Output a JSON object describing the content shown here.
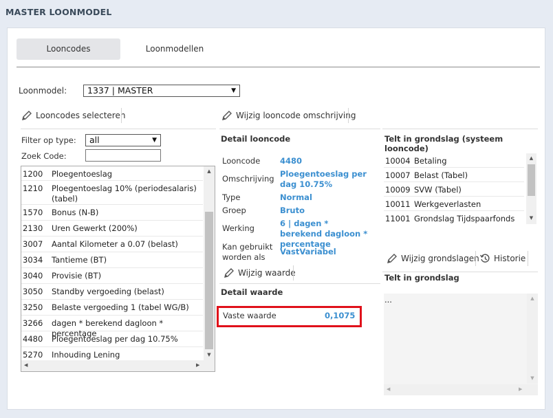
{
  "page": {
    "title": "MASTER LOONMODEL"
  },
  "tabs": [
    {
      "label": "Looncodes",
      "active": true
    },
    {
      "label": "Loonmodellen",
      "active": false
    }
  ],
  "loonmodel": {
    "label": "Loonmodel:",
    "value": "1337 | MASTER"
  },
  "toolbar": {
    "select_codes": "Looncodes selecteren",
    "edit_description": "Wijzig looncode omschrijving",
    "edit_value": "Wijzig waarde",
    "edit_grondslagen": "Wijzig grondslagen",
    "history": "Historie"
  },
  "filter": {
    "type_label": "Filter op type:",
    "type_value": "all",
    "search_label": "Zoek Code:",
    "search_value": ""
  },
  "looncodes": [
    {
      "code": "1200",
      "description": "Ploegentoeslag"
    },
    {
      "code": "1210",
      "description": "Ploegentoeslag 10% (periodesalaris) (tabel)"
    },
    {
      "code": "1570",
      "description": "Bonus (N-B)"
    },
    {
      "code": "2130",
      "description": "Uren Gewerkt (200%)"
    },
    {
      "code": "3007",
      "description": "Aantal Kilometer a 0.07 (belast)"
    },
    {
      "code": "3034",
      "description": "Tantieme (BT)"
    },
    {
      "code": "3040",
      "description": "Provisie (BT)"
    },
    {
      "code": "3050",
      "description": "Standby vergoeding (belast)"
    },
    {
      "code": "3250",
      "description": "Belaste vergoeding 1 (tabel WG/B)"
    },
    {
      "code": "3266",
      "description": "dagen * berekend dagloon * percentage"
    },
    {
      "code": "4480",
      "description": "Ploegentoeslag per dag 10.75%"
    },
    {
      "code": "5270",
      "description": "Inhouding Lening"
    }
  ],
  "detail": {
    "heading": "Detail looncode",
    "looncode_label": "Looncode",
    "looncode": "4480",
    "omschrijving_label": "Omschrijving",
    "omschrijving": "Ploegentoeslag per dag 10.75%",
    "type_label": "Type",
    "type": "Normal",
    "groep_label": "Groep",
    "groep": "Bruto",
    "werking_label": "Werking",
    "werking": "6 | dagen * berekend dagloon * percentage",
    "gebruik_label": "Kan gebruikt worden als",
    "gebruik": "VastVariabel"
  },
  "detail_waarde": {
    "heading": "Detail waarde",
    "label": "Vaste waarde",
    "value": "0,1075"
  },
  "grondslag_system": {
    "heading": "Telt in grondslag (systeem looncode)",
    "rows": [
      {
        "code": "10004",
        "description": "Betaling"
      },
      {
        "code": "10007",
        "description": "Belast (Tabel)"
      },
      {
        "code": "10009",
        "description": "SVW (Tabel)"
      },
      {
        "code": "10011",
        "description": "Werkgeverlasten"
      },
      {
        "code": "11001",
        "description": "Grondslag Tijdspaarfonds"
      }
    ]
  },
  "grondslag": {
    "heading": "Telt in grondslag",
    "content": "..."
  },
  "colors": {
    "accent": "#3b8fd0",
    "highlight": "#e0101a",
    "background": "#e6ebf3"
  }
}
